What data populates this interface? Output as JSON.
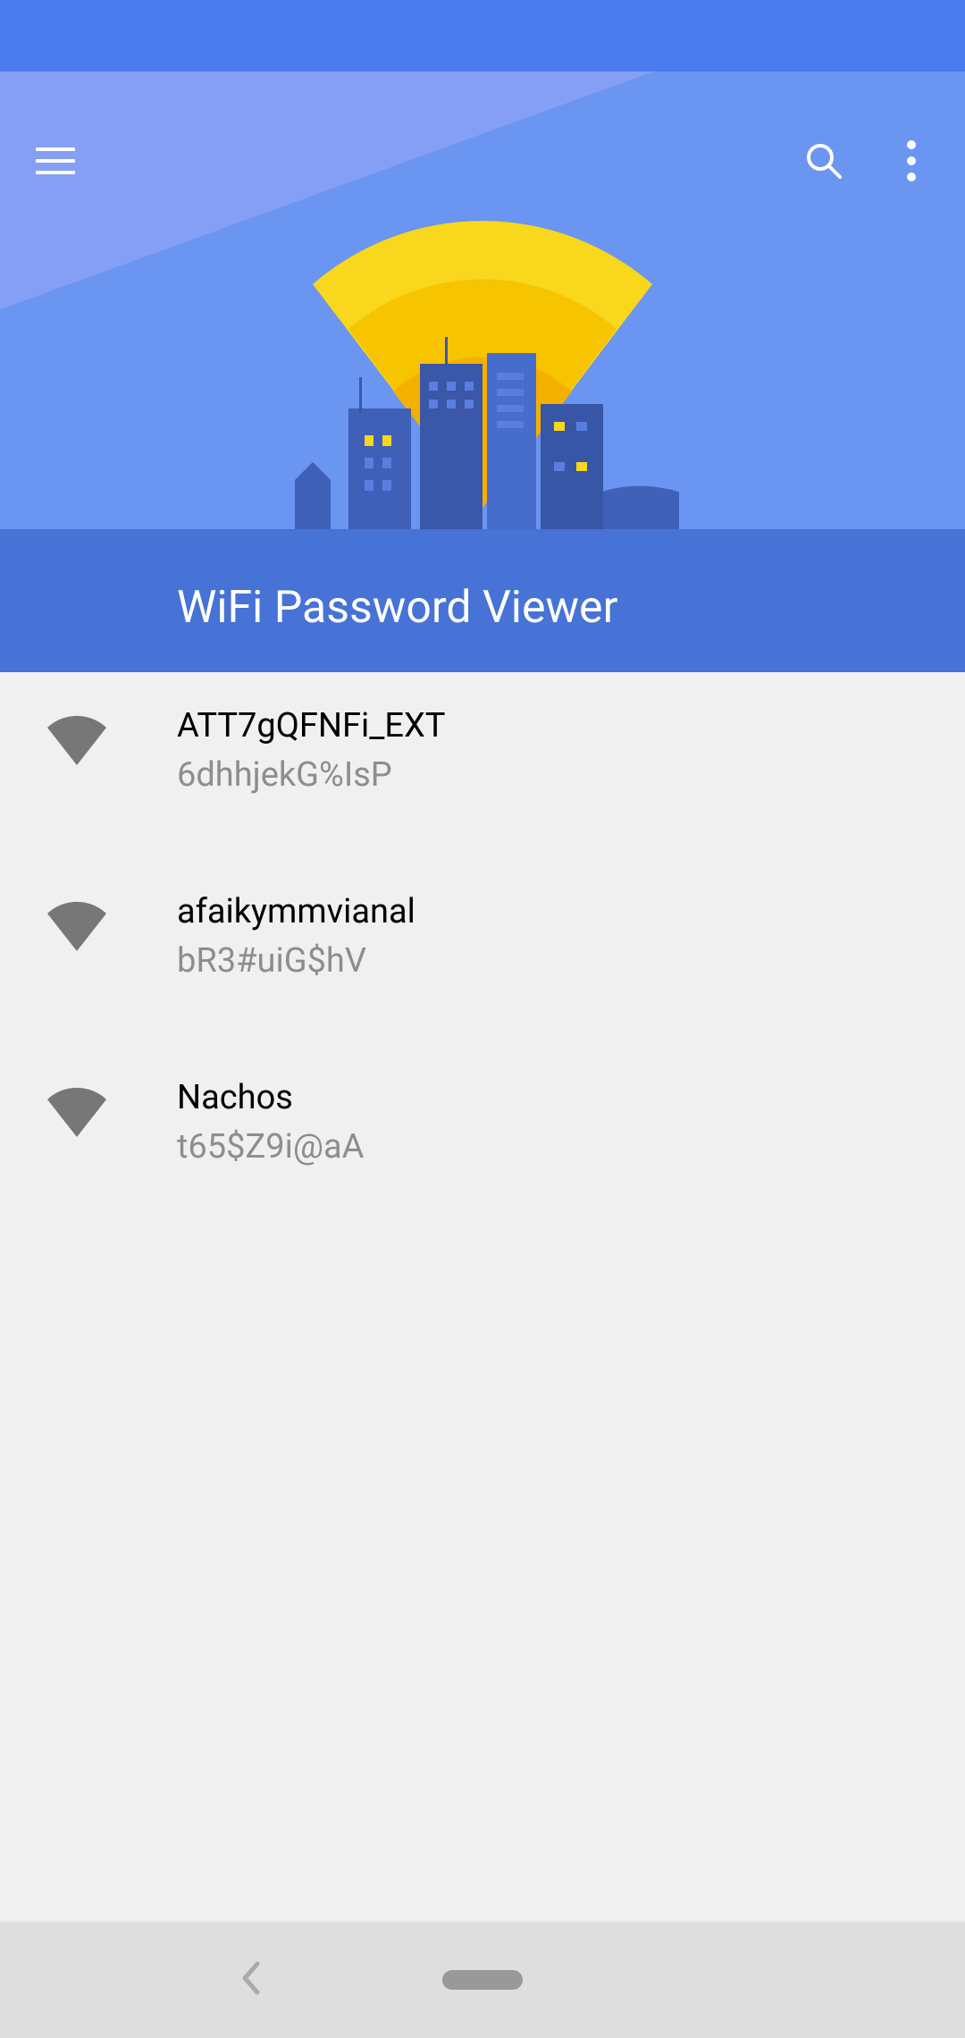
{
  "app": {
    "title": "WiFi Password Viewer"
  },
  "networks": [
    {
      "ssid": "ATT7gQFNFi_EXT",
      "password": "6dhhjekG%IsP"
    },
    {
      "ssid": "afaikymmvianal",
      "password": "bR3#uiG$hV"
    },
    {
      "ssid": "Nachos",
      "password": "t65$Z9i@aA"
    }
  ]
}
